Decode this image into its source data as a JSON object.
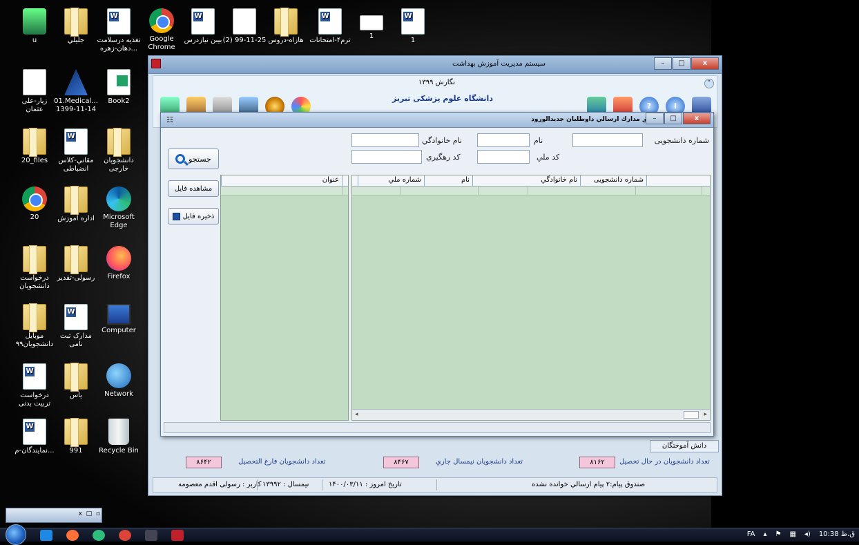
{
  "desktop": {
    "icons": [
      {
        "label": "u",
        "type": "user"
      },
      {
        "label": "جليلي",
        "type": "folder"
      },
      {
        "label": "تغذيه درسلامت دهان-زهره...",
        "type": "word"
      },
      {
        "label": "Google Chrome",
        "type": "chrome"
      },
      {
        "label": "بیبن نیازدرس",
        "type": "word"
      },
      {
        "label": "(2) 99-11-25",
        "type": "doc"
      },
      {
        "label": "هازاه-دروس",
        "type": "folder"
      },
      {
        "label": "ترم۴-امتحانات",
        "type": "word"
      },
      {
        "label": "1",
        "type": "mail"
      },
      {
        "label": "1",
        "type": "word"
      },
      {
        "label": "زیار-علی عثمان",
        "type": "doc"
      },
      {
        "label": "01.Medical... 1399-11-14",
        "type": "vs"
      },
      {
        "label": "Book2",
        "type": "excel"
      },
      {
        "label": "20_files",
        "type": "folder"
      },
      {
        "label": "مقاني-کلاس انضباطی",
        "type": "word"
      },
      {
        "label": "دانشجويان خارجی",
        "type": "folder"
      },
      {
        "label": "20",
        "type": "chrome"
      },
      {
        "label": "اداره آموزش",
        "type": "folder"
      },
      {
        "label": "Microsoft Edge",
        "type": "edge"
      },
      {
        "label": "درخواست دانشجويان",
        "type": "folder"
      },
      {
        "label": "رسولی-تقدير",
        "type": "folder"
      },
      {
        "label": "Firefox",
        "type": "firefox"
      },
      {
        "label": "موبایل دانشجويان۹۹",
        "type": "folder"
      },
      {
        "label": "مدارک ثبت نامی",
        "type": "word"
      },
      {
        "label": "Computer",
        "type": "computer"
      },
      {
        "label": "درخواست تربیت بدنی",
        "type": "word"
      },
      {
        "label": "یاس",
        "type": "folder"
      },
      {
        "label": "Network",
        "type": "network"
      },
      {
        "label": "نمایندگان-م...",
        "type": "word"
      },
      {
        "label": "991",
        "type": "folder"
      },
      {
        "label": "Recycle Bin",
        "type": "bin"
      }
    ]
  },
  "app": {
    "title": "سيستم مديريت آموزش بهداشت",
    "version": "نگارش ۱۳۹۹",
    "university": "دانشگاه علوم پزشکی تبریز",
    "students_tab": "دانش آموختگان",
    "stats": {
      "graduated_label": "تعداد دانشجويان فارغ التحصيل",
      "graduated_value": "۸۶۴۲",
      "current_sem_label": "تعداد دانشجويان نيمسال جاري",
      "current_sem_value": "۸۴۶۷",
      "studying_label": "تعداد دانشجويان در حال تحصيل",
      "studying_value": "۸۱۶۲"
    },
    "status": {
      "user": "کاربر : رسولی اقدم معصومه",
      "semester": "نيمسال : ۱۳۹۹۲",
      "date": "تاريخ امروز : ۱۴۰۰/۰۳/۱۱",
      "messages": "صندوق پيام:۲ پيام ارسالي خوانده نشده"
    }
  },
  "dialog": {
    "title": "تطابق مدارك ارسالي داوطلبان جديدالورود",
    "fields": {
      "student_number_label": "شماره دانشجويی",
      "first_name_label": "نام",
      "last_name_label": "نام خانوادگي",
      "national_code_label": "کد ملي",
      "tracking_code_label": "کد رهگيري"
    },
    "search_button": "جستجو",
    "view_file_button": "مشاهده فايل",
    "save_file_button": "ذخيره فايل",
    "files_grid": {
      "columns": [
        "عنوان"
      ]
    },
    "students_grid": {
      "columns": [
        "شماره دانشجويی",
        "نام خانوادگي",
        "نام",
        "شماره ملي"
      ]
    }
  },
  "taskbar": {
    "language": "FA",
    "time": "10:38 ق.ظ"
  },
  "colors": {
    "grid_bg": "#c2dcc4",
    "stat_value_bg": "#f3c6dc",
    "title_bar": "#a7c2e0"
  }
}
